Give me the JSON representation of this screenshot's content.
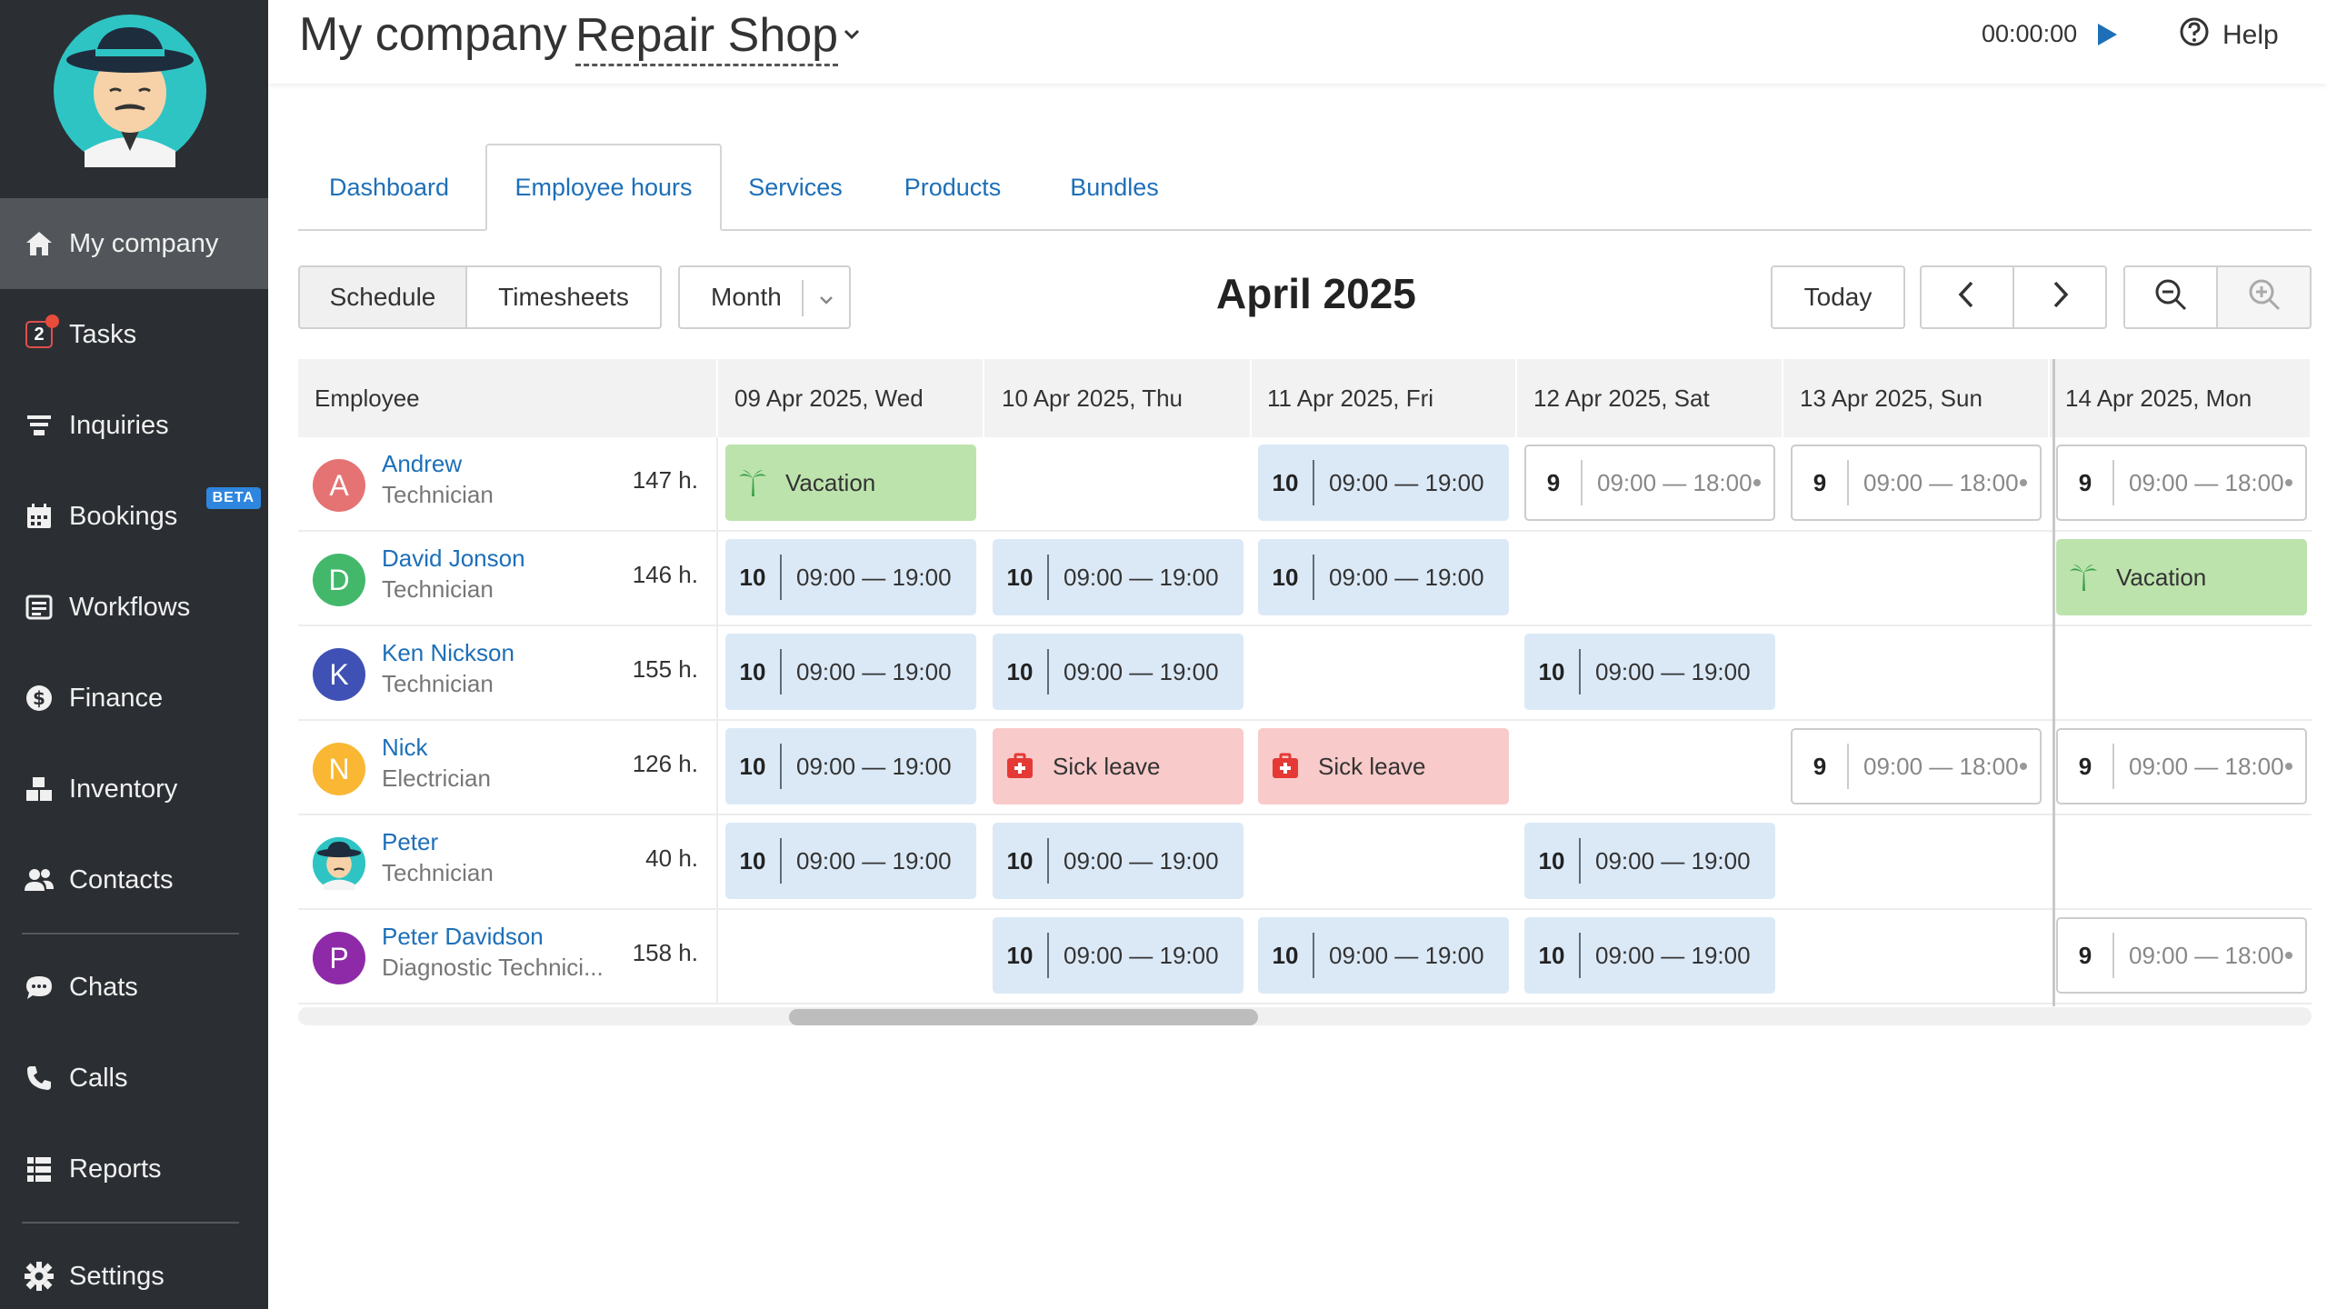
{
  "sidebar": {
    "items": [
      {
        "label": "My company",
        "icon": "home-icon",
        "active": true
      },
      {
        "label": "Tasks",
        "icon": "tasks-icon",
        "badge": "2"
      },
      {
        "label": "Inquiries",
        "icon": "funnel-icon"
      },
      {
        "label": "Bookings",
        "icon": "calendar-icon",
        "tag": "BETA"
      },
      {
        "label": "Workflows",
        "icon": "workflow-icon"
      },
      {
        "label": "Finance",
        "icon": "dollar-icon"
      },
      {
        "label": "Inventory",
        "icon": "boxes-icon"
      },
      {
        "label": "Contacts",
        "icon": "people-icon"
      },
      {
        "label": "Chats",
        "icon": "chat-icon"
      },
      {
        "label": "Calls",
        "icon": "phone-icon"
      },
      {
        "label": "Reports",
        "icon": "reports-icon"
      },
      {
        "label": "Settings",
        "icon": "gear-icon"
      }
    ]
  },
  "header": {
    "company": "My company",
    "shop": "Repair Shop",
    "timer": "00:00:00",
    "help": "Help"
  },
  "tabs": [
    "Dashboard",
    "Employee hours",
    "Services",
    "Products",
    "Bundles"
  ],
  "toolbar": {
    "schedule": "Schedule",
    "timesheets": "Timesheets",
    "period": "Month",
    "title": "April 2025",
    "today": "Today"
  },
  "grid": {
    "employee_header": "Employee",
    "days": [
      "09 Apr 2025, Wed",
      "10 Apr 2025, Thu",
      "11 Apr 2025, Fri",
      "12 Apr 2025, Sat",
      "13 Apr 2025, Sun",
      "14 Apr 2025, Mon"
    ],
    "rows": [
      {
        "initial": "A",
        "color": "#e57373",
        "name": "Andrew",
        "role": "Technician",
        "hours": "147 h.",
        "cells": [
          {
            "type": "vac",
            "label": "Vacation"
          },
          null,
          {
            "type": "work",
            "hrs": "10",
            "range": "09:00 — 19:00"
          },
          {
            "type": "alt",
            "hrs": "9",
            "range": "09:00 — 18:00"
          },
          {
            "type": "alt",
            "hrs": "9",
            "range": "09:00 — 18:00"
          },
          {
            "type": "alt",
            "hrs": "9",
            "range": "09:00 — 18:00"
          }
        ]
      },
      {
        "initial": "D",
        "color": "#43b86b",
        "name": "David Jonson",
        "role": "Technician",
        "hours": "146 h.",
        "cells": [
          {
            "type": "work",
            "hrs": "10",
            "range": "09:00 — 19:00"
          },
          {
            "type": "work",
            "hrs": "10",
            "range": "09:00 — 19:00"
          },
          {
            "type": "work",
            "hrs": "10",
            "range": "09:00 — 19:00"
          },
          null,
          null,
          {
            "type": "vac",
            "label": "Vacation"
          }
        ]
      },
      {
        "initial": "K",
        "color": "#3f51b5",
        "name": "Ken Nickson",
        "role": "Technician",
        "hours": "155 h.",
        "cells": [
          {
            "type": "work",
            "hrs": "10",
            "range": "09:00 — 19:00"
          },
          {
            "type": "work",
            "hrs": "10",
            "range": "09:00 — 19:00"
          },
          null,
          {
            "type": "work",
            "hrs": "10",
            "range": "09:00 — 19:00"
          },
          null,
          null
        ]
      },
      {
        "initial": "N",
        "color": "#f9b733",
        "name": "Nick",
        "role": "Electrician",
        "hours": "126 h.",
        "cells": [
          {
            "type": "work",
            "hrs": "10",
            "range": "09:00 — 19:00"
          },
          {
            "type": "sick",
            "label": "Sick leave"
          },
          {
            "type": "sick",
            "label": "Sick leave"
          },
          null,
          {
            "type": "alt",
            "hrs": "9",
            "range": "09:00 — 18:00"
          },
          {
            "type": "alt",
            "hrs": "9",
            "range": "09:00 — 18:00"
          }
        ]
      },
      {
        "initial": "",
        "color": "#2ec4c4",
        "name": "Peter",
        "role": "Technician",
        "hours": "40 h.",
        "photo": true,
        "cells": [
          {
            "type": "work",
            "hrs": "10",
            "range": "09:00 — 19:00"
          },
          {
            "type": "work",
            "hrs": "10",
            "range": "09:00 — 19:00"
          },
          null,
          {
            "type": "work",
            "hrs": "10",
            "range": "09:00 — 19:00"
          },
          null,
          null
        ]
      },
      {
        "initial": "P",
        "color": "#8e2aa8",
        "name": "Peter Davidson",
        "role": "Diagnostic Technici...",
        "hours": "158 h.",
        "cells": [
          null,
          {
            "type": "work",
            "hrs": "10",
            "range": "09:00 — 19:00"
          },
          {
            "type": "work",
            "hrs": "10",
            "range": "09:00 — 19:00"
          },
          {
            "type": "work",
            "hrs": "10",
            "range": "09:00 — 19:00"
          },
          null,
          {
            "type": "alt",
            "hrs": "9",
            "range": "09:00 — 18:00"
          }
        ]
      }
    ]
  },
  "colors": {
    "accent": "#1d6fb8",
    "sidebar": "#2b2f33",
    "work": "#dbe9f7",
    "vacation": "#bde3ad",
    "sick": "#f9caca"
  }
}
